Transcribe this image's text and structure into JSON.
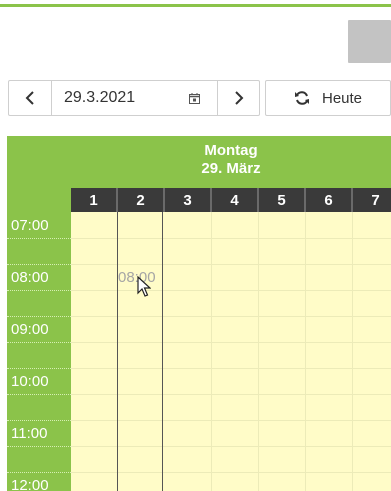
{
  "toolbar": {
    "prev_icon": "chevron-left-icon",
    "date_value": "29.3.2021",
    "calendar_icon": "calendar-icon",
    "next_icon": "chevron-right-icon",
    "refresh_icon": "refresh-icon",
    "today_label": "Heute"
  },
  "day_header": {
    "weekday": "Montag",
    "date": "29. März"
  },
  "resources": [
    "1",
    "2",
    "3",
    "4",
    "5",
    "6",
    "7"
  ],
  "times": [
    "07:00",
    "08:00",
    "09:00",
    "10:00",
    "11:00",
    "12:00"
  ],
  "hover_time": "08:00",
  "colors": {
    "accent_green": "#8bc34a",
    "header_dark": "#3a3a3a",
    "slot_bg": "#fffcc8",
    "ghost_text": "#a5a5a5"
  }
}
